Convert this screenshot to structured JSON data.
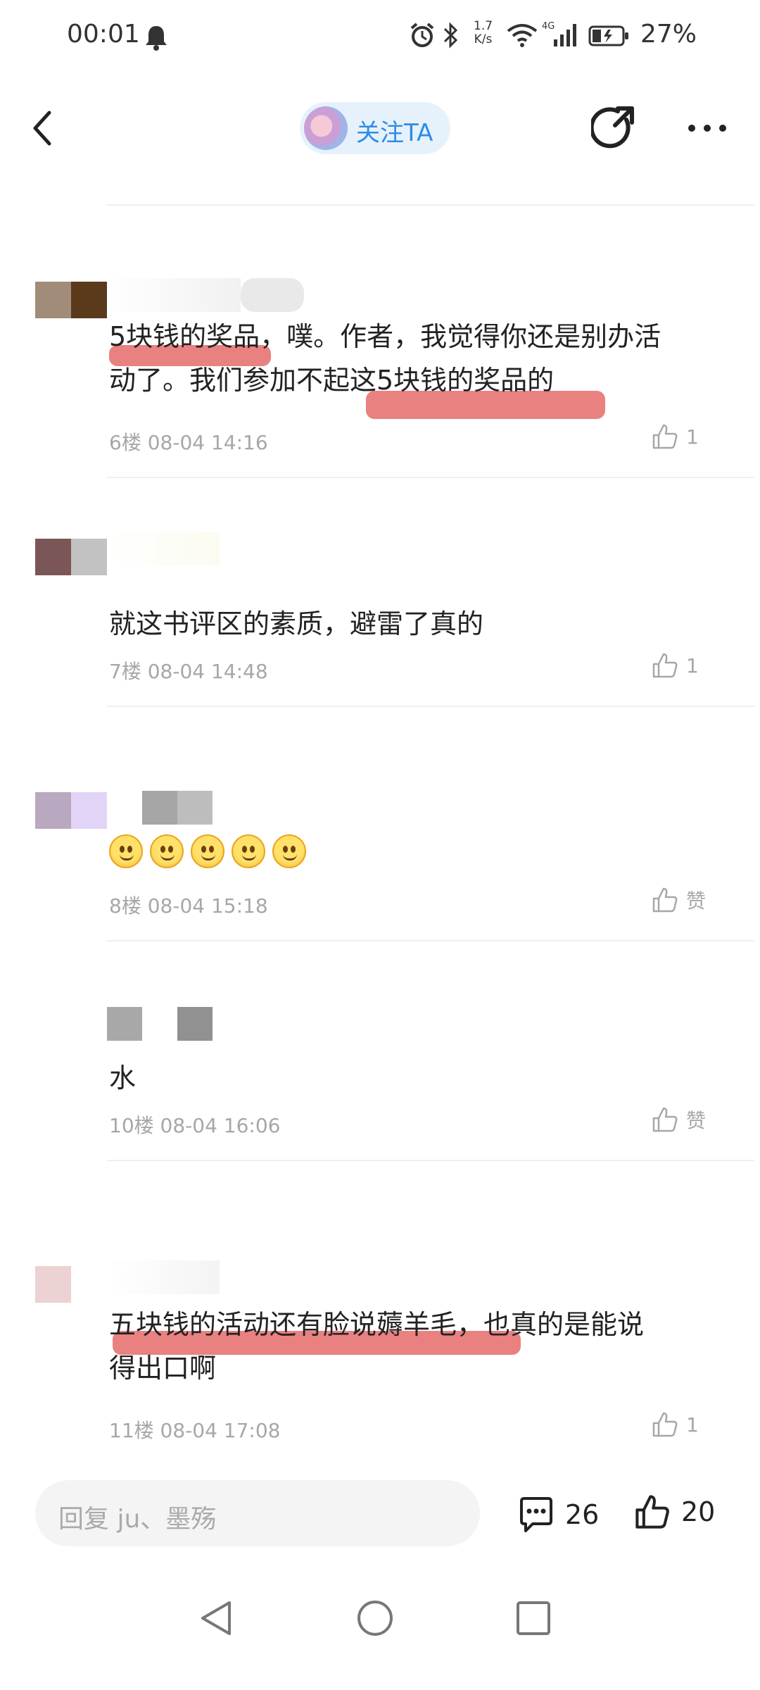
{
  "status_bar": {
    "time": "00:01",
    "net_speed_value": "1.7",
    "net_speed_unit": "K/s",
    "signal_label": "4G",
    "battery": "27%"
  },
  "header": {
    "follow_label": "关注TA"
  },
  "comments": [
    {
      "text_line1": "5块钱的奖品，噗。作者，我觉得你还是别办活",
      "text_line2": "动了。我们参加不起这5块钱的奖品的",
      "meta": "6楼 08-04 14:16",
      "likes": "1"
    },
    {
      "text_line1": "就这书评区的素质，避雷了真的",
      "meta": "7楼 08-04 14:48",
      "likes": "1"
    },
    {
      "emoji_count": 5,
      "meta": "8楼 08-04 15:18",
      "likes": "赞"
    },
    {
      "text_line1": "水",
      "meta": "10楼 08-04 16:06",
      "likes": "赞"
    },
    {
      "text_line1": "五块钱的活动还有脸说薅羊毛，也真的是能说",
      "text_line2": "得出口啊",
      "meta": "11楼 08-04 17:08",
      "likes": "1"
    }
  ],
  "bottom_bar": {
    "reply_placeholder": "回复 ju、墨殇",
    "comment_count": "26",
    "like_count": "20"
  },
  "colors": {
    "highlight": "#e87a7a",
    "accent": "#2f8be6",
    "meta_gray": "#a7a7a7"
  }
}
